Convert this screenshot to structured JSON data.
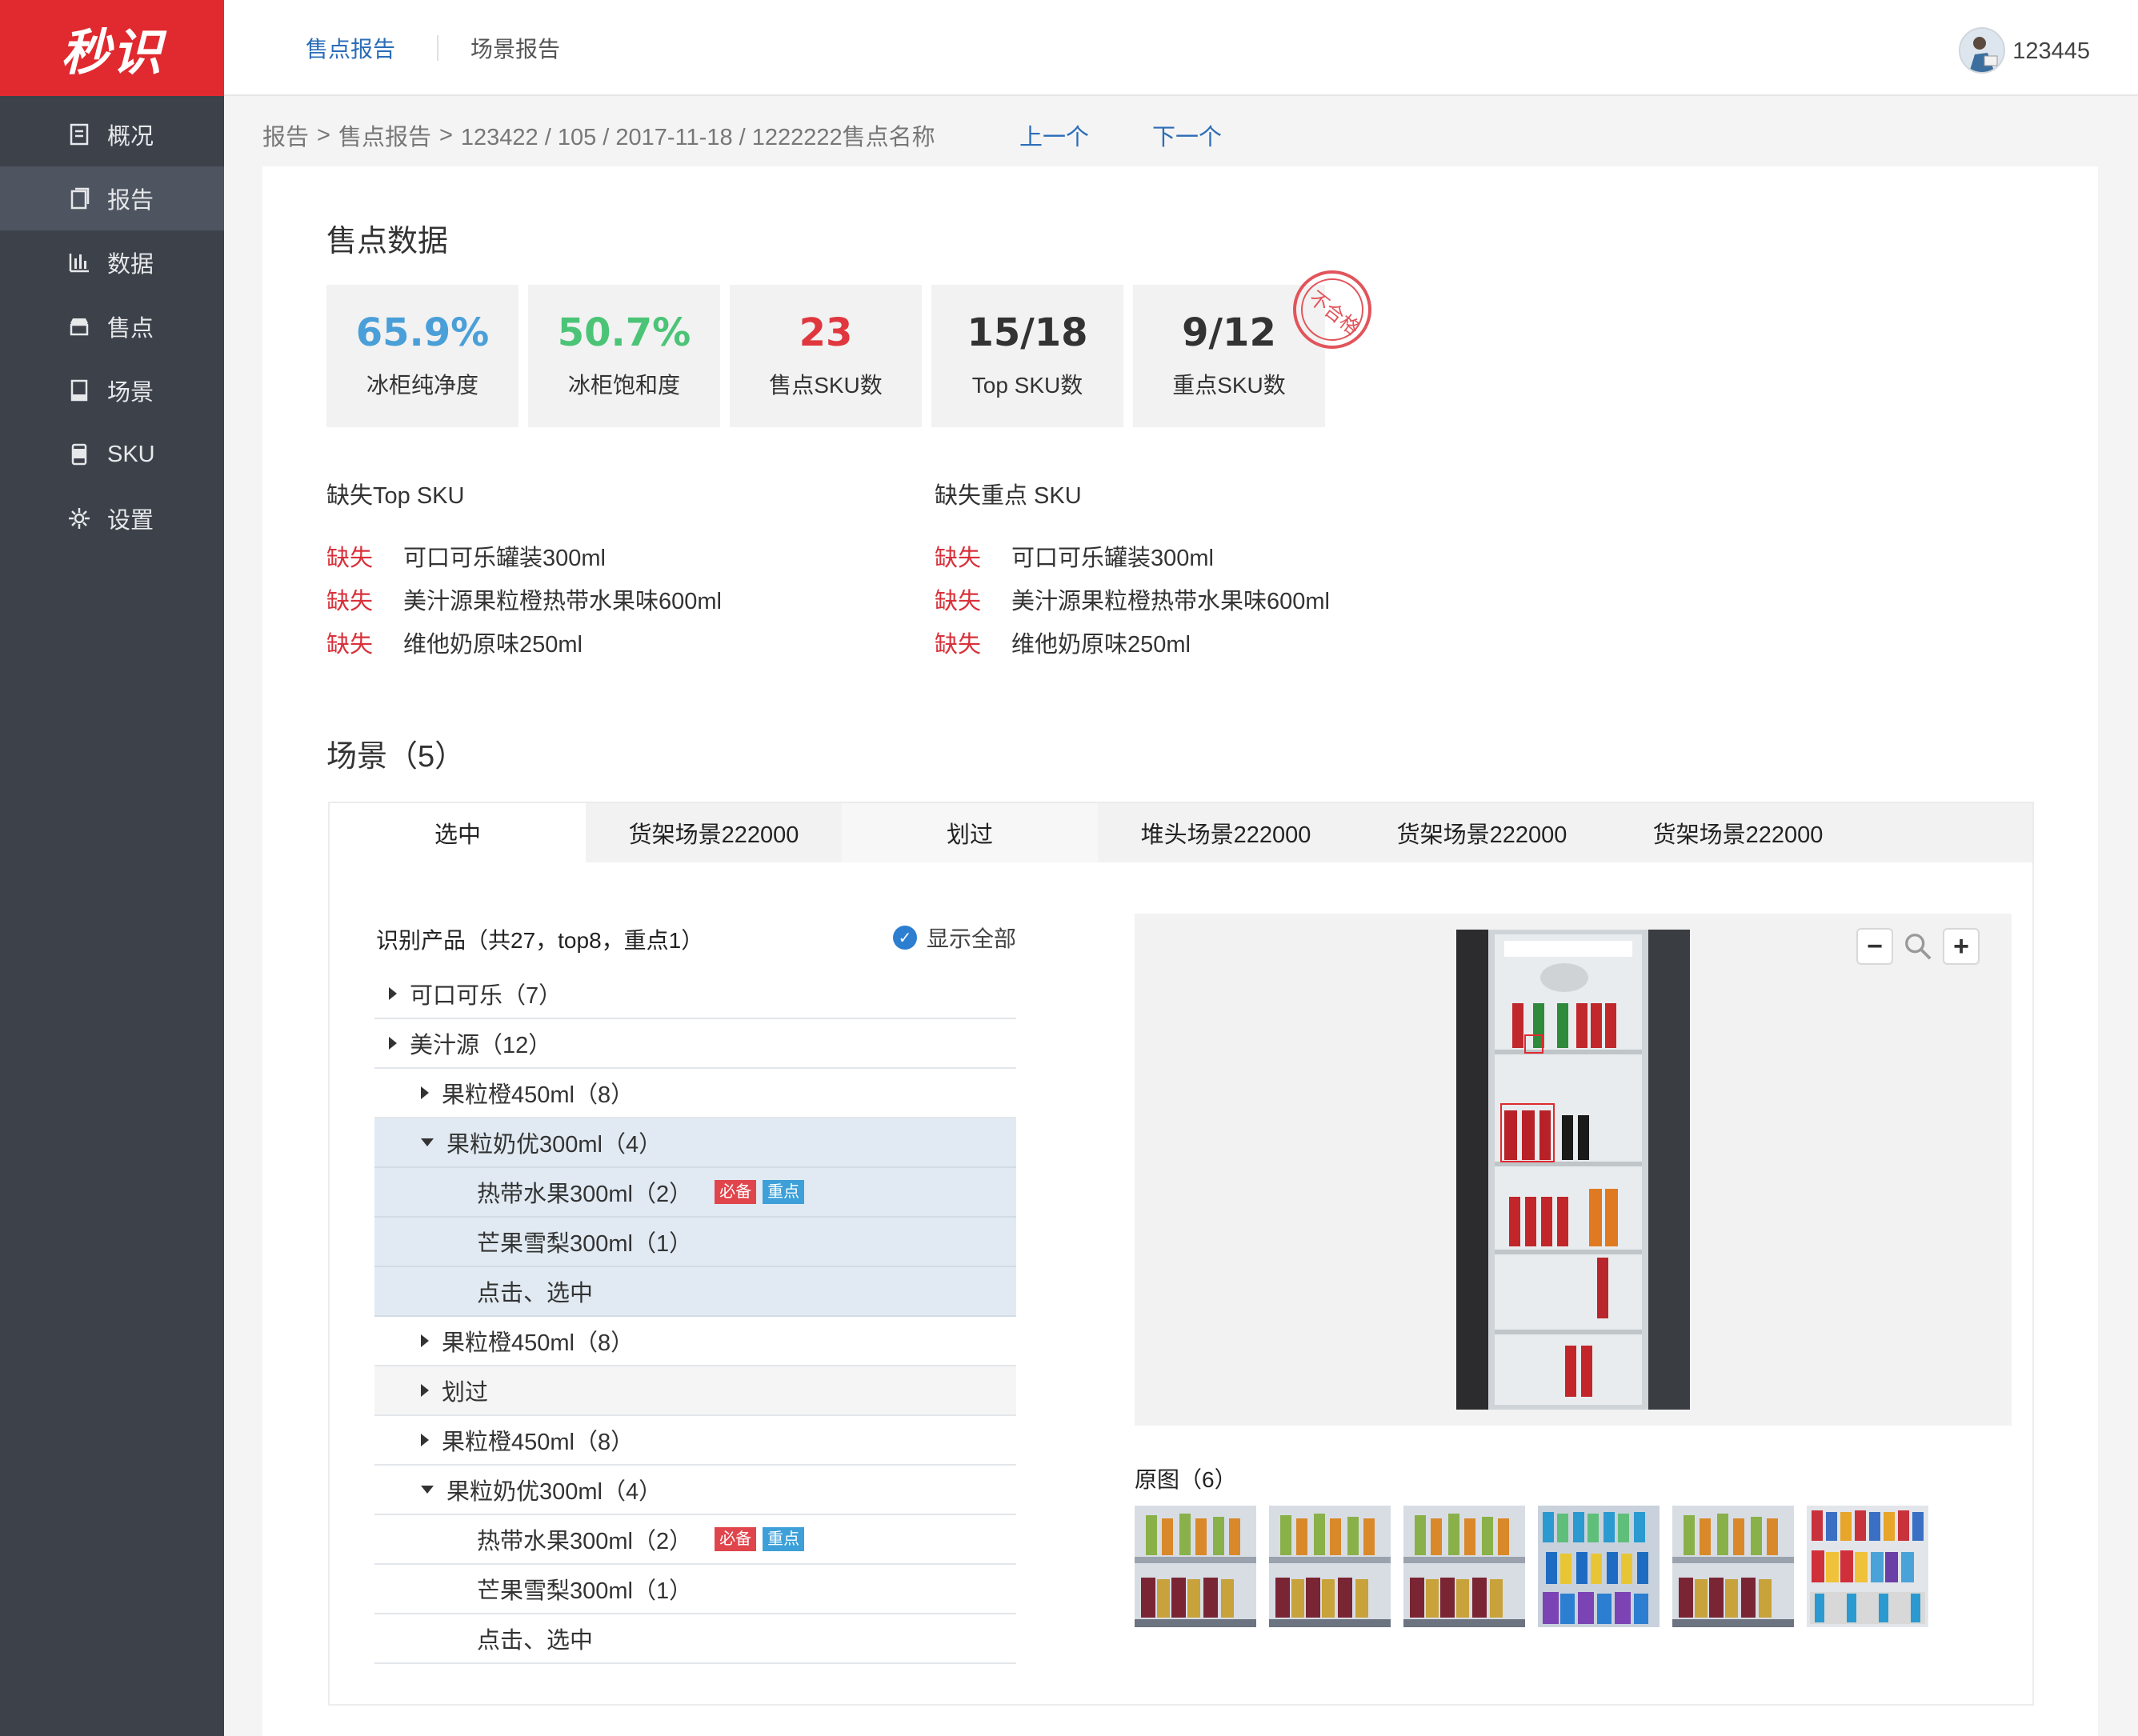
{
  "app": {
    "logo": "秒识"
  },
  "sidebar": {
    "items": [
      {
        "label": "概况",
        "icon": "overview-icon"
      },
      {
        "label": "报告",
        "icon": "report-icon",
        "active": true
      },
      {
        "label": "数据",
        "icon": "bar-chart-icon"
      },
      {
        "label": "售点",
        "icon": "store-icon"
      },
      {
        "label": "场景",
        "icon": "scene-icon"
      },
      {
        "label": "SKU",
        "icon": "sku-icon"
      },
      {
        "label": "设置",
        "icon": "gear-icon"
      }
    ]
  },
  "header": {
    "tabs": [
      {
        "label": "售点报告",
        "active": true
      },
      {
        "label": "场景报告",
        "active": false
      }
    ],
    "username": "123445"
  },
  "breadcrumb": {
    "items": [
      "报告",
      "售点报告",
      "123422 / 105 / 2017-11-18 / 1222222售点名称"
    ],
    "separator": ">",
    "prev": "上一个",
    "next": "下一个"
  },
  "store_data": {
    "title": "售点数据",
    "stats": [
      {
        "value": "65.9%",
        "label": "冰柜纯净度",
        "color": "#4a9fd8"
      },
      {
        "value": "50.7%",
        "label": "冰柜饱和度",
        "color": "#4cc477"
      },
      {
        "value": "23",
        "label": "售点SKU数",
        "color": "#e0373f"
      },
      {
        "value": "15/18",
        "label": "Top SKU数",
        "color": "#333333"
      },
      {
        "value": "9/12",
        "label": "重点SKU数",
        "color": "#333333"
      }
    ],
    "stamp": "不合格",
    "missing_top": {
      "title": "缺失Top SKU",
      "items": [
        {
          "tag": "缺失",
          "name": "可口可乐罐装300ml"
        },
        {
          "tag": "缺失",
          "name": "美汁源果粒橙热带水果味600ml"
        },
        {
          "tag": "缺失",
          "name": "维他奶原味250ml"
        }
      ]
    },
    "missing_key": {
      "title": "缺失重点 SKU",
      "items": [
        {
          "tag": "缺失",
          "name": "可口可乐罐装300ml"
        },
        {
          "tag": "缺失",
          "name": "美汁源果粒橙热带水果味600ml"
        },
        {
          "tag": "缺失",
          "name": "维他奶原味250ml"
        }
      ]
    }
  },
  "scenes": {
    "title": "场景（5）",
    "tabs": [
      "选中",
      "货架场景222000",
      "划过",
      "堆头场景222000",
      "货架场景222000",
      "货架场景222000"
    ],
    "products_title": "识别产品（共27，top8，重点1）",
    "show_all": "显示全部",
    "tree": [
      {
        "label": "可口可乐（7）"
      },
      {
        "label": "美汁源（12）"
      },
      {
        "label": "果粒橙450ml（8）"
      },
      {
        "label": "果粒奶优300ml（4）"
      },
      {
        "label": "热带水果300ml（2）",
        "badges": [
          "必备",
          "重点"
        ]
      },
      {
        "label": "芒果雪梨300ml（1）"
      },
      {
        "label": "点击、选中"
      },
      {
        "label": "果粒橙450ml（8）"
      },
      {
        "label": "划过"
      },
      {
        "label": "果粒橙450ml（8）"
      },
      {
        "label": "果粒奶优300ml（4）"
      },
      {
        "label": "热带水果300ml（2）",
        "badges": [
          "必备",
          "重点"
        ]
      },
      {
        "label": "芒果雪梨300ml（1）"
      },
      {
        "label": "点击、选中"
      }
    ],
    "original_title": "原图（6）"
  }
}
